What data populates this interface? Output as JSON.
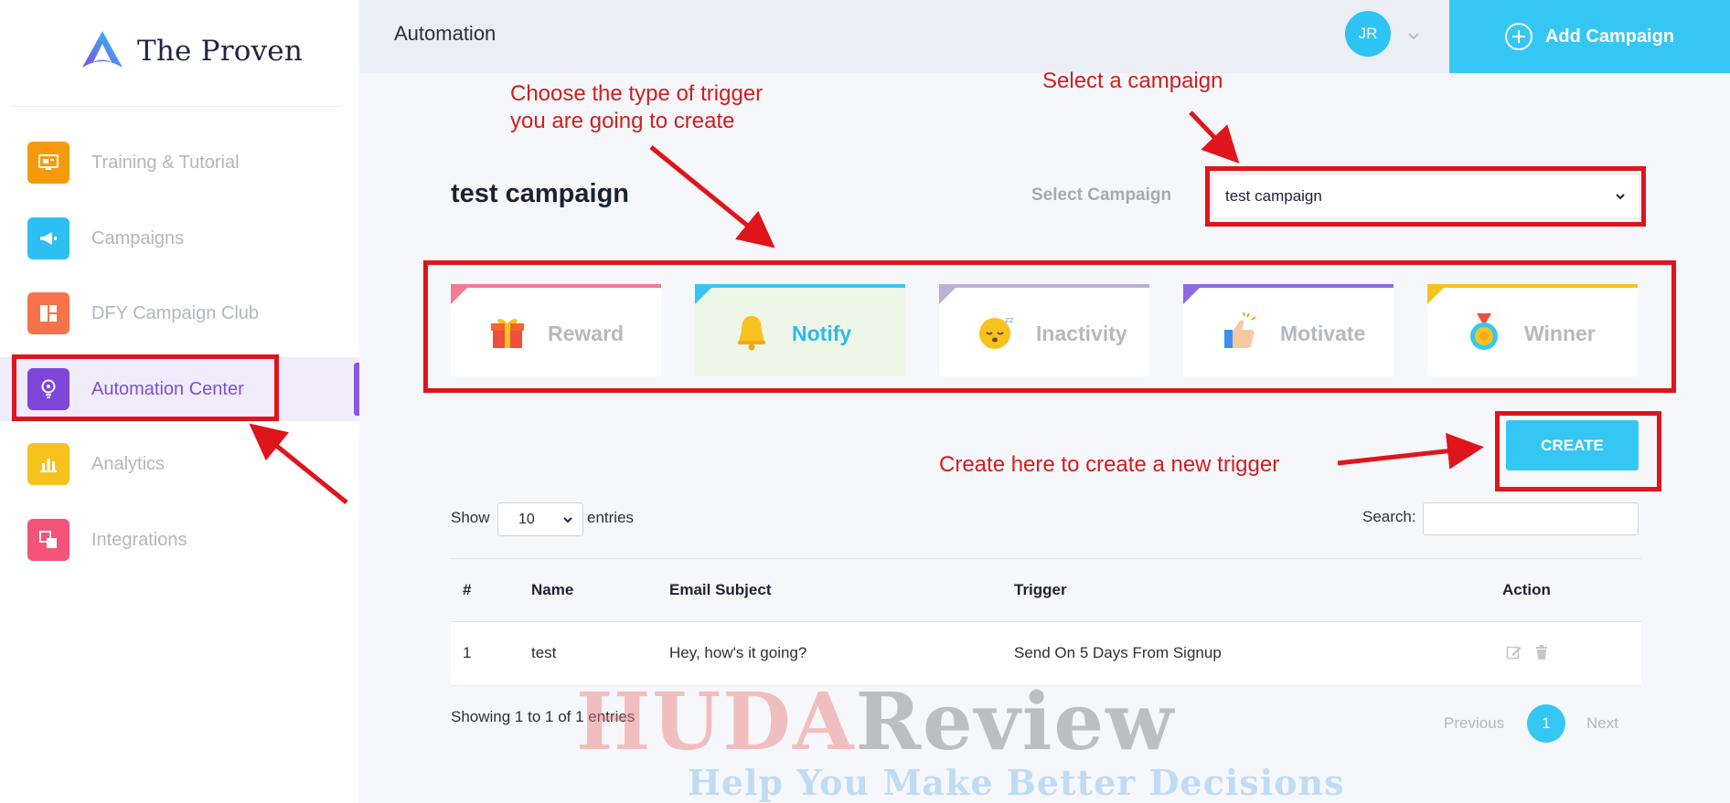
{
  "brand": {
    "name": "The Proven"
  },
  "sidebar": {
    "items": [
      {
        "label": "Training & Tutorial",
        "icon": "training-icon",
        "color": "#f59a0c"
      },
      {
        "label": "Campaigns",
        "icon": "megaphone-icon",
        "color": "#2dbff2"
      },
      {
        "label": "DFY Campaign Club",
        "icon": "layout-icon",
        "color": "#f5734a"
      },
      {
        "label": "Automation Center",
        "icon": "lightbulb-icon",
        "color": "#7d46d9",
        "active": true
      },
      {
        "label": "Analytics",
        "icon": "bar-chart-icon",
        "color": "#f7c21e"
      },
      {
        "label": "Integrations",
        "icon": "integrations-icon",
        "color": "#f2547a"
      }
    ]
  },
  "header": {
    "title": "Automation",
    "avatar_initials": "JR",
    "add_campaign_label": "Add Campaign"
  },
  "main": {
    "campaign_title": "test campaign",
    "select_campaign_label": "Select Campaign",
    "selected_campaign": "test campaign",
    "trigger_types": [
      {
        "label": "Reward",
        "icon": "gift-icon",
        "accent": "#f07b93"
      },
      {
        "label": "Notify",
        "icon": "bell-icon",
        "accent": "#35c7f4",
        "selected": true
      },
      {
        "label": "Inactivity",
        "icon": "sleepy-face-icon",
        "accent": "#b9b1d6"
      },
      {
        "label": "Motivate",
        "icon": "clapping-hand-icon",
        "accent": "#8c6ae0"
      },
      {
        "label": "Winner",
        "icon": "medal-icon",
        "accent": "#f7c21e"
      }
    ],
    "create_label": "CREATE",
    "show_label": "Show",
    "entries_value": "10",
    "entries_label": "entries",
    "search_label": "Search:",
    "table": {
      "columns": [
        "#",
        "Name",
        "Email Subject",
        "Trigger",
        "Action"
      ],
      "rows": [
        {
          "num": "1",
          "name": "test",
          "subject": "Hey, how's it going?",
          "trigger": "Send On 5 Days From Signup"
        }
      ]
    },
    "showing_text": "Showing 1 to 1 of 1 entries",
    "pagination": {
      "previous": "Previous",
      "page": "1",
      "next": "Next"
    }
  },
  "annotations": {
    "trigger_note_line1": "Choose the type of trigger",
    "trigger_note_line2": "you are going to create",
    "campaign_note": "Select a campaign",
    "create_note": "Create here to create a new trigger"
  },
  "watermark": {
    "part1": "HUDA",
    "part2": "Review",
    "tagline": "Help You Make Better Decisions"
  }
}
